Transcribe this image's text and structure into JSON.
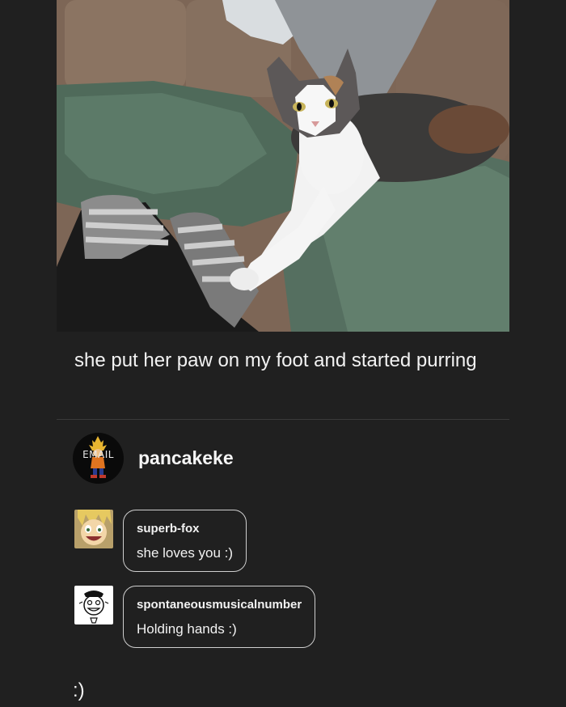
{
  "post": {
    "caption": "she put her paw on my foot and started purring"
  },
  "reblogger": {
    "avatar_text": "EMAIL",
    "username": "pancakeke"
  },
  "replies": [
    {
      "username": "superb-fox",
      "message": "she loves you :)"
    },
    {
      "username": "spontaneousmusicalnumber",
      "message": "Holding hands :)"
    }
  ],
  "footer_text": ":)",
  "icons": {
    "photo": "cat-photo",
    "reblogger_avatar": "anime-character-avatar",
    "reply_1_avatar": "cartoon-face-avatar",
    "reply_2_avatar": "sketch-face-avatar"
  },
  "colors": {
    "background": "#202020",
    "text": "#f2f2f2",
    "bubble_border": "#cfcfcf"
  }
}
